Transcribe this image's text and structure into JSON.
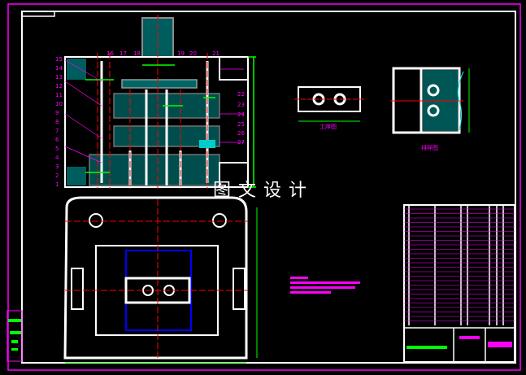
{
  "watermark": "图文设计",
  "part_labels_left": [
    "15",
    "14",
    "13",
    "12",
    "11",
    "10",
    "9",
    "8",
    "7",
    "6",
    "5",
    "4",
    "3",
    "2",
    "1"
  ],
  "part_labels_top": [
    "16",
    "17",
    "18",
    "19",
    "20",
    "21"
  ],
  "part_labels_right": [
    "22",
    "23",
    "24",
    "25",
    "26",
    "27"
  ],
  "captions": {
    "part_view": "工序图",
    "strip_layout": "排样图"
  },
  "colors": {
    "background": "#000000",
    "outline": "#ffffff",
    "frame": "#ff00ff",
    "dimension": "#00ff00",
    "centerline": "#ff0000",
    "hatch": "#00ffff"
  }
}
